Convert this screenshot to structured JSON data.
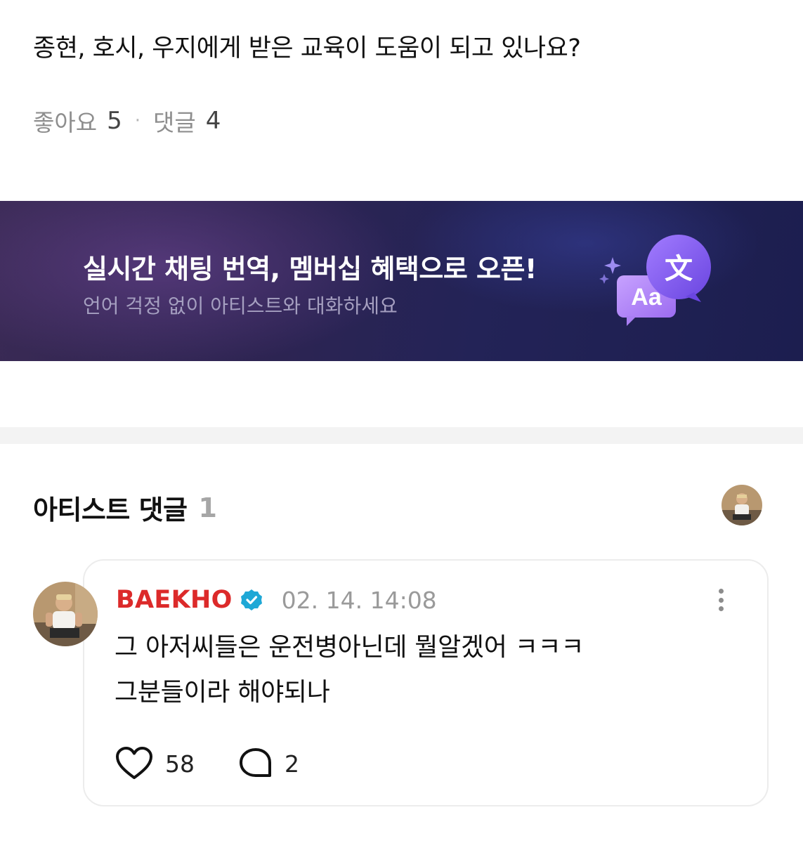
{
  "post": {
    "text": "종현, 호시, 우지에게 받은 교육이 도움이 되고 있나요?",
    "likes_label": "좋아요",
    "likes_count": "5",
    "separator": "·",
    "comments_label": "댓글",
    "comments_count": "4"
  },
  "banner": {
    "title": "실시간 채팅 번역, 멤버십 혜택으로 오픈!",
    "subtitle": "언어 걱정 없이 아티스트와 대화하세요",
    "bubble_front_text": "Aa",
    "bubble_back_text": "文",
    "icon": "translate-bubbles-icon"
  },
  "artist_comments": {
    "title": "아티스트 댓글",
    "count": "1"
  },
  "comment": {
    "author": "BAEKHO",
    "verified_icon": "verified-badge-icon",
    "timestamp": "02. 14. 14:08",
    "body": "그 아저씨들은 운전병아닌데 뭘알겠어 ㅋㅋㅋ\n그분들이라 해야되나",
    "like_count": "58",
    "reply_count": "2"
  },
  "colors": {
    "author_name": "#dc2a2a",
    "verified_badge": "#1fa8d6",
    "banner_accent": "#8a58e8"
  }
}
